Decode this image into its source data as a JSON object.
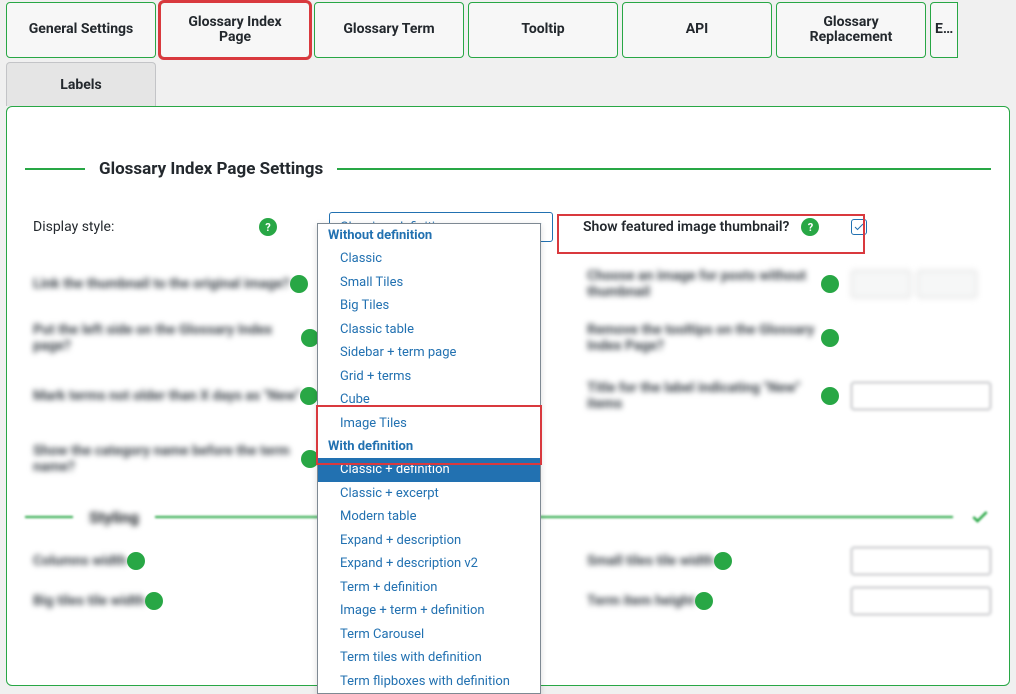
{
  "tabs": {
    "items": [
      "General Settings",
      "Glossary Index\nPage",
      "Glossary Term",
      "Tooltip",
      "API",
      "Glossary\nReplacement",
      "E…"
    ],
    "activeIndex": 1
  },
  "subtabs": {
    "items": [
      "Labels"
    ],
    "activeIndex": 0
  },
  "section_title": "Glossary Index Page Settings",
  "display_style": {
    "label": "Display style:",
    "value": "Classic + definition",
    "groups": [
      {
        "label": "Without definition",
        "options": [
          "Classic",
          "Small Tiles",
          "Big Tiles",
          "Classic table",
          "Sidebar + term page",
          "Grid + terms",
          "Cube",
          "Image Tiles"
        ]
      },
      {
        "label": "With definition",
        "options": [
          "Classic + definition",
          "Classic + excerpt",
          "Modern table",
          "Expand + description",
          "Expand + description v2",
          "Term + definition",
          "Image + term + definition",
          "Term Carousel",
          "Term tiles with definition",
          "Term flipboxes with definition"
        ]
      }
    ],
    "selected": "Classic + definition"
  },
  "featured_image": {
    "label": "Show featured image thumbnail?",
    "checked": true
  },
  "colors": {
    "accent": "#28a745",
    "link": "#2271b1",
    "highlight": "#d9393e"
  }
}
